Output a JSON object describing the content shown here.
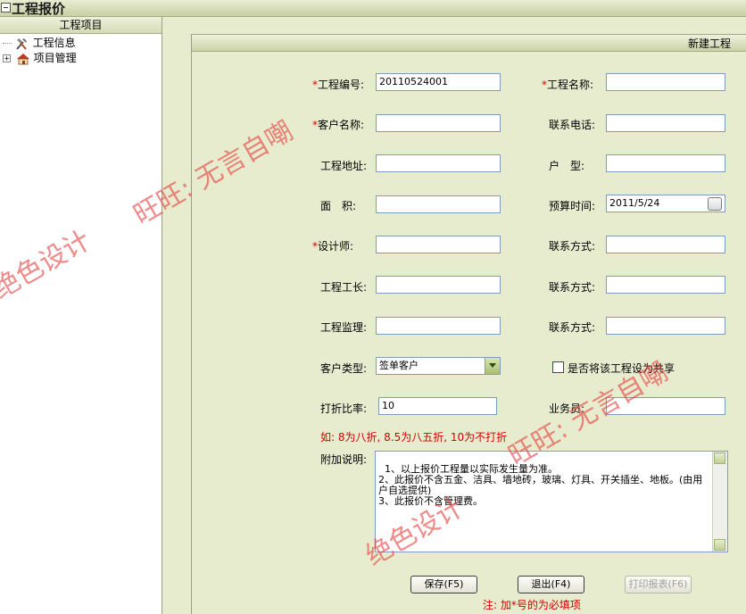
{
  "window": {
    "title": "工程报价"
  },
  "sidebar": {
    "header": "工程项目",
    "items": [
      {
        "label": "工程信息",
        "icon": "tools-icon"
      },
      {
        "label": "项目管理",
        "icon": "house-icon",
        "expander": "+"
      }
    ]
  },
  "panel": {
    "title": "新建工程"
  },
  "form": {
    "project_no": {
      "label": "工程编号:",
      "value": "20110524001",
      "required": true
    },
    "project_name": {
      "label": "工程名称:",
      "value": "",
      "required": true
    },
    "client_name": {
      "label": "客户名称:",
      "value": "",
      "required": true
    },
    "phone": {
      "label": "联系电话:",
      "value": ""
    },
    "address": {
      "label": "工程地址:",
      "value": ""
    },
    "house_type": {
      "label": "户　型:",
      "value": ""
    },
    "area": {
      "label": "面　积:",
      "value": ""
    },
    "budget_time": {
      "label": "预算时间:",
      "value": "2011/5/24"
    },
    "designer": {
      "label": "设计师:",
      "value": "",
      "required": true
    },
    "designer_contact": {
      "label": "联系方式:",
      "value": ""
    },
    "foreman": {
      "label": "工程工长:",
      "value": ""
    },
    "foreman_contact": {
      "label": "联系方式:",
      "value": ""
    },
    "supervisor": {
      "label": "工程监理:",
      "value": ""
    },
    "supervisor_contact": {
      "label": "联系方式:",
      "value": ""
    },
    "client_type": {
      "label": "客户类型:",
      "value": "签单客户"
    },
    "share": {
      "label": "是否将该工程设为共享",
      "checked": false
    },
    "discount": {
      "label": "打折比率:",
      "value": "10"
    },
    "salesman": {
      "label": "业务员:",
      "value": ""
    },
    "discount_hint": "如: 8为八折, 8.5为八五折, 10为不打折",
    "remarks": {
      "label": "附加说明:",
      "value": "1、以上报价工程量以实际发生量为准。\n2、此报价不含五金、洁具、墙地砖，玻璃、灯具、开关插坐、地板。(由用户自选提供)\n3、此报价不含管理费。"
    }
  },
  "buttons": {
    "save": "保存(F5)",
    "exit": "退出(F4)",
    "print": "打印报表(F6)"
  },
  "footnote": "注: 加*号的为必填项",
  "watermarks": [
    "旺旺: 无言自嘲",
    "绝色设计",
    "旺旺: 无言自嘲",
    "绝色设计"
  ],
  "colors": {
    "accent": "#d00000",
    "frame": "#e8eccf"
  }
}
